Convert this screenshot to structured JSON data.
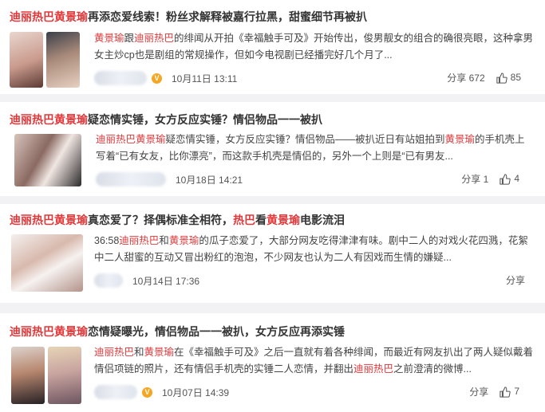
{
  "posts": [
    {
      "title_parts": [
        {
          "t": "迪丽热巴黄景瑜",
          "hl": true
        },
        {
          "t": "再添恋爱线索！粉丝求解释被嘉行拉黑，甜蜜细节再被扒",
          "hl": false
        }
      ],
      "body_parts": [
        {
          "t": "黄景瑜",
          "hl": true
        },
        {
          "t": "跟",
          "hl": false
        },
        {
          "t": "迪丽热巴",
          "hl": true
        },
        {
          "t": "的绯闻从开拍《幸福触手可及》开始传出，俊男靓女的组合的确很亮眼，这种拿男女主炒cp也是剧组的常规操作，但如今电视剧已经播完好几个月了...",
          "hl": false
        }
      ],
      "date": "10月11日 13:11",
      "share_label": "分享",
      "share_count": "672",
      "like_count": "85",
      "verified": "V"
    },
    {
      "title_parts": [
        {
          "t": "迪丽热巴黄景瑜",
          "hl": true
        },
        {
          "t": "疑恋情实锤，女方反应实锤？情侣物品一一被扒",
          "hl": false
        }
      ],
      "body_parts": [
        {
          "t": "迪丽热巴黄景瑜",
          "hl": true
        },
        {
          "t": "疑恋情实锤，女方反应实锤？情侣物品——被扒近日有站姐拍到",
          "hl": false
        },
        {
          "t": "黄景瑜",
          "hl": true
        },
        {
          "t": "的手机壳上写着“已有女友，比你漂亮”，而这款手机壳是情侣的，另外一个上则是“已有男友...",
          "hl": false
        }
      ],
      "date": "10月18日 14:21",
      "share_label": "分享",
      "share_count": "1",
      "like_count": "4",
      "verified": ""
    },
    {
      "title_parts": [
        {
          "t": "迪丽热巴黄景瑜",
          "hl": true
        },
        {
          "t": "真恋爱了？择偶标准全相符，",
          "hl": false
        },
        {
          "t": "热巴",
          "hl": true
        },
        {
          "t": "看",
          "hl": false
        },
        {
          "t": "黄景瑜",
          "hl": true
        },
        {
          "t": "电影流泪",
          "hl": false
        }
      ],
      "body_parts": [
        {
          "t": "36:58",
          "hl": false
        },
        {
          "t": "迪丽热巴",
          "hl": true
        },
        {
          "t": "和",
          "hl": false
        },
        {
          "t": "黄景瑜",
          "hl": true
        },
        {
          "t": "的瓜子恋爱了，大部分网友吃得津津有味。剧中二人的对戏火花四溅，花絮中二人甜蜜的互动又冒出粉红的泡泡，不少网友也认为二人有因戏而生情的嫌疑...",
          "hl": false
        }
      ],
      "date": "10月14日 17:36",
      "share_label": "分享",
      "share_count": "",
      "like_count": "",
      "verified": ""
    },
    {
      "title_parts": [
        {
          "t": "迪丽热巴黄景瑜",
          "hl": true
        },
        {
          "t": "恋情疑曝光，情侣物品一一被扒，女方反应再添实锤",
          "hl": false
        }
      ],
      "body_parts": [
        {
          "t": "迪丽热巴",
          "hl": true
        },
        {
          "t": "和",
          "hl": false
        },
        {
          "t": "黄景瑜",
          "hl": true
        },
        {
          "t": "在《幸福触手可及》之后一直就有着各种绯闻，而最近有网友扒出了两人疑似戴着情侣项链的照片，还有情侣手机壳的实锤二人恋情，并翻出",
          "hl": false
        },
        {
          "t": "迪丽热巴",
          "hl": true
        },
        {
          "t": "之前澄清的微博...",
          "hl": false
        }
      ],
      "date": "10月07日 14:39",
      "share_label": "分享",
      "share_count": "",
      "like_count": "7",
      "verified": "V"
    }
  ],
  "colors": {
    "highlight": "#e0383a",
    "background": "#f2f2f5",
    "badge": "#f5a623"
  }
}
